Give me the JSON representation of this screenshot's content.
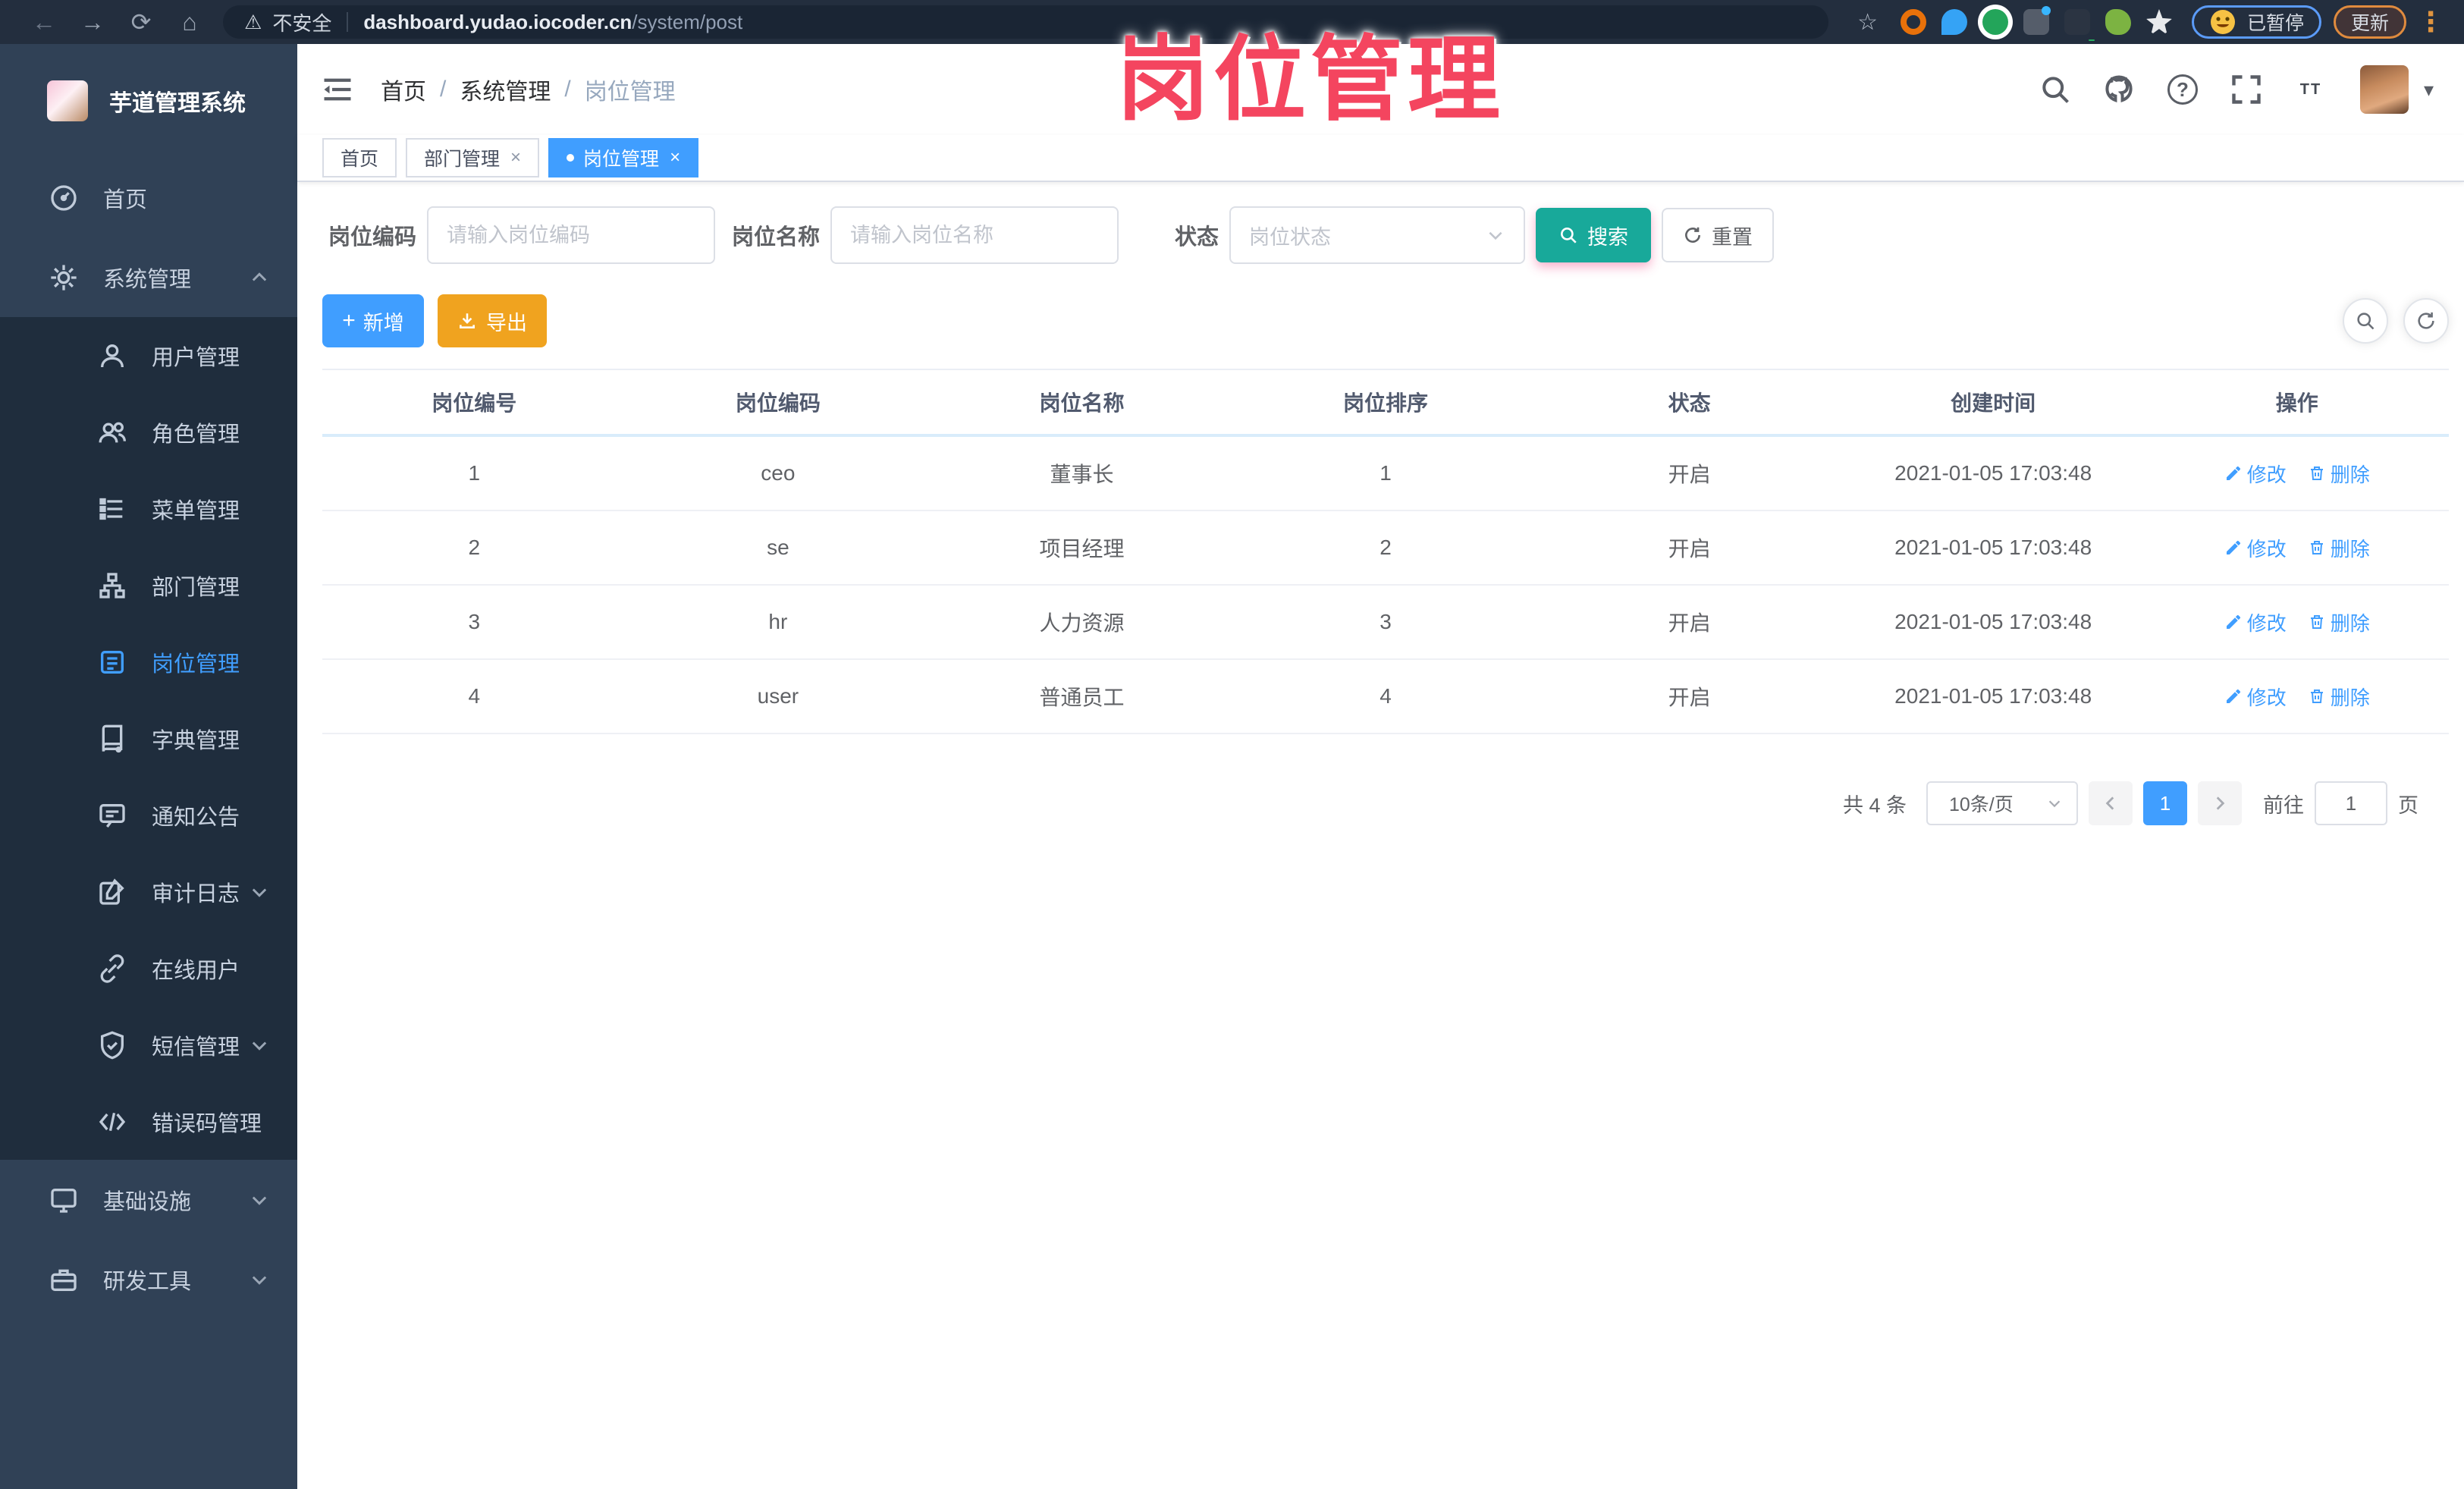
{
  "icons": {
    "back": "←",
    "forward": "→",
    "reload": "⟳",
    "home": "⌂",
    "warning": "⚠",
    "star": "☆",
    "caret": "▾",
    "menu_dots": "⋮",
    "question": "?",
    "font_size_big": "T",
    "font_size_small": "T",
    "close": "×",
    "plus": "+",
    "crumb_sep": "/"
  },
  "browser": {
    "security_label": "不安全",
    "url_host": "dashboard.yudao.iocoder.cn",
    "url_path": "/system/post",
    "paused_badge": "已暂停",
    "update_label": "更新"
  },
  "overlay_title": "岗位管理",
  "sidebar": {
    "app_title": "芋道管理系统",
    "items": {
      "home": "首页",
      "system": "系统管理",
      "user": "用户管理",
      "role": "角色管理",
      "menu": "菜单管理",
      "dept": "部门管理",
      "post": "岗位管理",
      "dict": "字典管理",
      "notice": "通知公告",
      "audit": "审计日志",
      "online": "在线用户",
      "sms": "短信管理",
      "errcode": "错误码管理",
      "infra": "基础设施",
      "devtool": "研发工具"
    }
  },
  "header": {
    "breadcrumb": {
      "home": "首页",
      "section": "系统管理",
      "current": "岗位管理"
    }
  },
  "tabs": [
    {
      "label": "首页"
    },
    {
      "label": "部门管理"
    },
    {
      "label": "岗位管理"
    }
  ],
  "filters": {
    "code_label": "岗位编码",
    "code_placeholder": "请输入岗位编码",
    "name_label": "岗位名称",
    "name_placeholder": "请输入岗位名称",
    "status_label": "状态",
    "status_placeholder": "岗位状态",
    "search_label": "搜索",
    "reset_label": "重置"
  },
  "toolbar": {
    "add_label": "新增",
    "export_label": "导出"
  },
  "table": {
    "headers": [
      "岗位编号",
      "岗位编码",
      "岗位名称",
      "岗位排序",
      "状态",
      "创建时间",
      "操作"
    ],
    "edit_label": "修改",
    "delete_label": "删除",
    "rows": [
      {
        "id": "1",
        "code": "ceo",
        "name": "董事长",
        "sort": "1",
        "status": "开启",
        "created": "2021-01-05 17:03:48"
      },
      {
        "id": "2",
        "code": "se",
        "name": "项目经理",
        "sort": "2",
        "status": "开启",
        "created": "2021-01-05 17:03:48"
      },
      {
        "id": "3",
        "code": "hr",
        "name": "人力资源",
        "sort": "3",
        "status": "开启",
        "created": "2021-01-05 17:03:48"
      },
      {
        "id": "4",
        "code": "user",
        "name": "普通员工",
        "sort": "4",
        "status": "开启",
        "created": "2021-01-05 17:03:48"
      }
    ]
  },
  "pagination": {
    "total": "共 4 条",
    "page_size": "10条/页",
    "current_page": "1",
    "goto_label": "前往",
    "goto_value": "1",
    "page_unit": "页"
  },
  "colors": {
    "accent": "#409eff",
    "search_button": "#18a99a",
    "export_button": "#f0a31f",
    "overlay_text": "#f4455f",
    "sidebar_bg": "#304156",
    "submenu_bg": "#1f2d3d"
  }
}
